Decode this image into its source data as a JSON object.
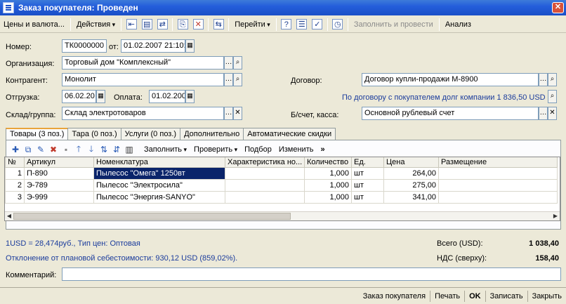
{
  "window": {
    "title": "Заказ покупателя: Проведен",
    "close": "✕"
  },
  "toolbar": {
    "prices": "Цены и валюта...",
    "actions": "Действия",
    "goto": "Перейти",
    "fill_post": "Заполнить и провести",
    "analysis": "Анализ"
  },
  "form": {
    "number_label": "Номер:",
    "number_value": "ТК0000000",
    "from_label": "от:",
    "date_value": "01.02.2007 21:10:",
    "org_label": "Организация:",
    "org_value": "Торговый дом \"Комплексный\"",
    "contractor_label": "Контрагент:",
    "contractor_value": "Монолит",
    "contract_label": "Договор:",
    "contract_value": "Договор купли-продажи М-8900",
    "shipment_label": "Отгрузка:",
    "shipment_value": "06.02.20",
    "payment_label": "Оплата:",
    "payment_value": "01.02.200",
    "debt_info": "По договору с покупателем долг компании 1 836,50 USD",
    "warehouse_label": "Склад/группа:",
    "warehouse_value": "Склад электротоваров",
    "account_label": "Б/счет, касса:",
    "account_value": "Основной рублевый счет"
  },
  "tabs": [
    {
      "label": "Товары (3 поз.)"
    },
    {
      "label": "Тара (0 поз.)"
    },
    {
      "label": "Услуги (0 поз.)"
    },
    {
      "label": "Дополнительно"
    },
    {
      "label": "Автоматические скидки"
    }
  ],
  "table_toolbar": {
    "fill": "Заполнить",
    "check": "Проверить",
    "select": "Подбор",
    "change": "Изменить"
  },
  "table": {
    "columns": [
      "№",
      "Артикул",
      "Номенклатура",
      "Характеристика но...",
      "Количество",
      "Ед.",
      "Цена",
      "Размещение"
    ],
    "rows": [
      {
        "n": "1",
        "sku": "П-890",
        "name": "Пылесос \"Омега\" 1250вт",
        "char": "",
        "qty": "1,000",
        "unit": "шт",
        "price": "264,00",
        "place": ""
      },
      {
        "n": "2",
        "sku": "Э-789",
        "name": "Пылесос \"Электросила\"",
        "char": "",
        "qty": "1,000",
        "unit": "шт",
        "price": "275,00",
        "place": ""
      },
      {
        "n": "3",
        "sku": "Э-999",
        "name": "Пылесос \"Энергия-SANYO\"",
        "char": "",
        "qty": "1,000",
        "unit": "шт",
        "price": "341,00",
        "place": ""
      }
    ]
  },
  "footer": {
    "rate_info": "1USD = 28,474руб., Тип цен: Оптовая",
    "deviation_info": "Отклонение от плановой себестоимости: 930,12 USD (859,02%).",
    "total_label": "Всего (USD):",
    "total_value": "1 038,40",
    "vat_label": "НДС (сверху):",
    "vat_value": "158,40",
    "comment_label": "Комментарий:",
    "comment_value": ""
  },
  "bottom": {
    "order": "Заказ покупателя",
    "print": "Печать",
    "ok": "OK",
    "save": "Записать",
    "close": "Закрыть"
  },
  "colors": {
    "title_bar": "#245edb",
    "selection": "#0a246a",
    "info_text": "#1b3c9c",
    "active_tab": "#e9a43a"
  }
}
